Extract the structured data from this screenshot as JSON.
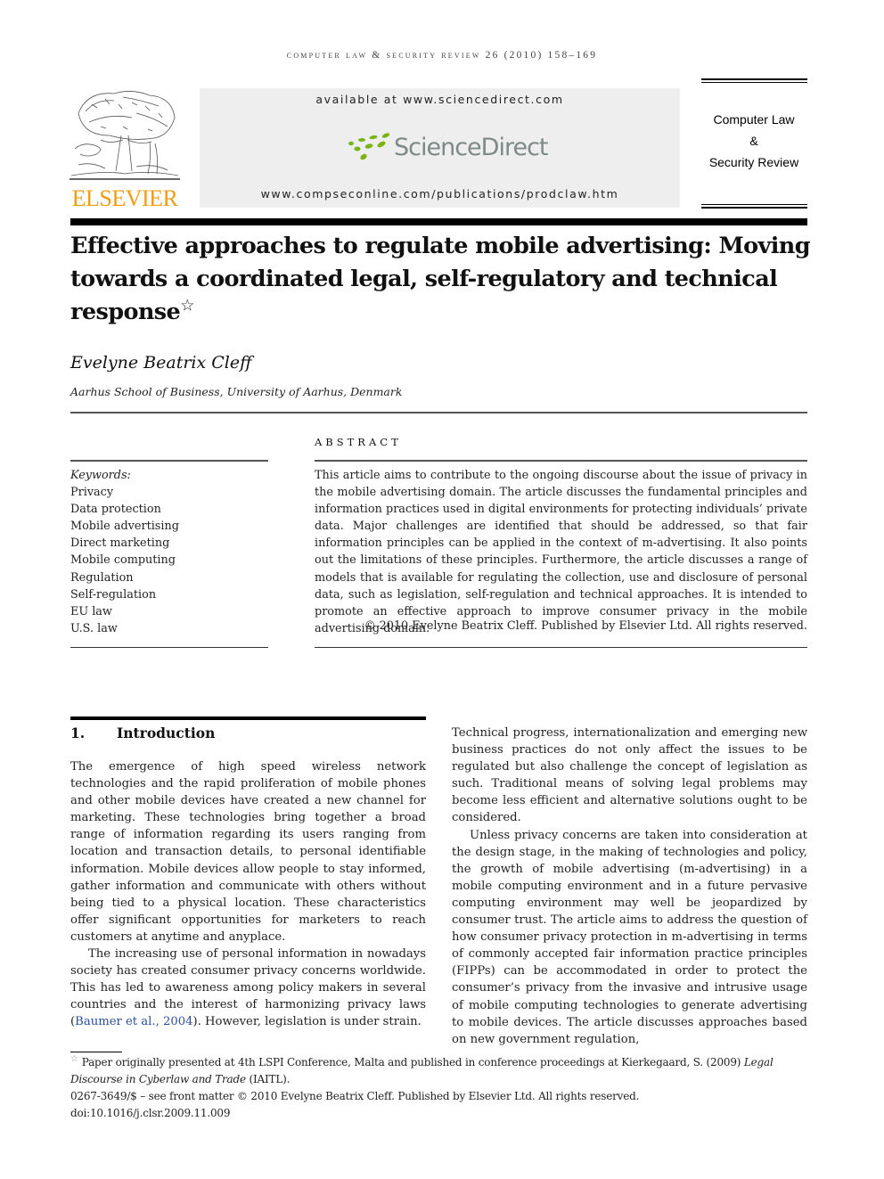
{
  "header": {
    "running_head": "computer law & security review 26 (2010) 158–169",
    "publisher_logo_text": "ELSEVIER",
    "sciencedirect": {
      "available_at": "available at www.sciencedirect.com",
      "brand": "ScienceDirect",
      "journal_url": "www.compseconline.com/publications/prodclaw.htm",
      "brand_color": "#7d8a87",
      "dots_color": "#7ab317"
    },
    "journal_title_lines": [
      "Computer Law",
      "&",
      "Security Review"
    ],
    "publisher_color": "#f39c12"
  },
  "article": {
    "title": "Effective approaches to regulate mobile advertising: Moving towards a coordinated legal, self-regulatory and technical response",
    "title_footnote_mark": "☆",
    "author": "Evelyne Beatrix Cleff",
    "affiliation": "Aarhus School of Business, University of Aarhus, Denmark"
  },
  "keywords": {
    "label": "Keywords:",
    "items": [
      "Privacy",
      "Data protection",
      "Mobile advertising",
      "Direct marketing",
      "Mobile computing",
      "Regulation",
      "Self-regulation",
      "EU law",
      "U.S. law"
    ]
  },
  "abstract": {
    "heading": "ABSTRACT",
    "text": "This article aims to contribute to the ongoing discourse about the issue of privacy in the mobile advertising domain. The article discusses the fundamental principles and information practices used in digital environments for protecting individuals’ private data. Major challenges are identified that should be addressed, so that fair information principles can be applied in the context of m-advertising. It also points out the limitations of these principles. Furthermore, the article discusses a range of models that is available for regulating the collection, use and disclosure of personal data, such as legislation, self-regulation and technical approaches. It is intended to promote an effective approach to improve consumer privacy in the mobile advertising domain.",
    "copyright": "© 2010 Evelyne Beatrix Cleff. Published by Elsevier Ltd. All rights reserved."
  },
  "section1": {
    "number": "1.",
    "title": "Introduction",
    "left_paragraphs": [
      "The emergence of high speed wireless network technologies and the rapid proliferation of mobile phones and other mobile devices have created a new channel for marketing. These technologies bring together a broad range of information regarding its users ranging from location and transaction details, to personal identifiable information. Mobile devices allow people to stay informed, gather information and communicate with others without being tied to a physical location. These characteristics offer significant opportunities for marketers to reach customers at anytime and anyplace."
    ],
    "left_p2_before_cite": "The increasing use of personal information in nowadays society has created consumer privacy concerns worldwide. This has led to awareness among policy makers in several countries and the interest of harmonizing privacy laws (",
    "left_p2_cite": "Baumer et al., 2004",
    "left_p2_after_cite": "). However, legislation is under strain.",
    "right_paragraphs": [
      "Technical progress, internationalization and emerging new business practices do not only affect the issues to be regulated but also challenge the concept of legislation as such. Traditional means of solving legal problems may become less efficient and alternative solutions ought to be considered.",
      "Unless privacy concerns are taken into consideration at the design stage, in the making of technologies and policy, the growth of mobile advertising (m-advertising) in a mobile computing environment and in a future pervasive computing environment may well be jeopardized by consumer trust. The article aims to address the question of how consumer privacy protection in m-advertising in terms of commonly accepted fair information practice principles (FIPPs) can be accommodated in order to protect the consumer’s privacy from the invasive and intrusive usage of mobile computing technologies to generate advertising to mobile devices. The article discusses approaches based on new government regulation,"
    ]
  },
  "footnotes": {
    "star_note_before": "Paper originally presented at 4th LSPI Conference, Malta and published in conference proceedings at Kierkegaard, S. (2009) ",
    "star_note_italic": "Legal Discourse in Cyberlaw and Trade",
    "star_note_after": " (IAITL).",
    "front_matter": "0267-3649/$ – see front matter © 2010 Evelyne Beatrix Cleff. Published by Elsevier Ltd. All rights reserved.",
    "doi": "doi:10.1016/j.clsr.2009.11.009"
  }
}
